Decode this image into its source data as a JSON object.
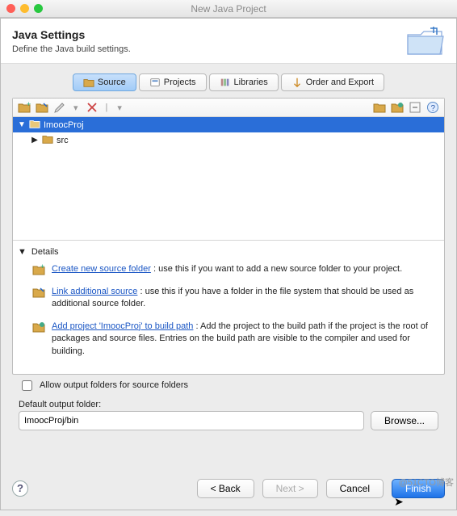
{
  "window": {
    "title": "New Java Project"
  },
  "header": {
    "title": "Java Settings",
    "subtitle": "Define the Java build settings."
  },
  "tabs": {
    "source": "Source",
    "projects": "Projects",
    "libraries": "Libraries",
    "order": "Order and Export"
  },
  "tree": {
    "project": "ImoocProj",
    "src": "src"
  },
  "details": {
    "heading": "Details",
    "item1": {
      "link": "Create new source folder",
      "text": " : use this if you want to add a new source folder to your project."
    },
    "item2": {
      "link": "Link additional source",
      "text": " : use this if you have a folder in the file system that should be used as additional source folder."
    },
    "item3": {
      "link": "Add project 'ImoocProj' to build path",
      "text": " : Add the project to the build path if the project is the root of packages and source files. Entries on the build path are visible to the compiler and used for building."
    }
  },
  "options": {
    "allow_label": "Allow output folders for source folders",
    "default_output_label": "Default output folder:",
    "default_output_value": "ImoocProj/bin",
    "browse": "Browse..."
  },
  "footer": {
    "back": "< Back",
    "next": "Next >",
    "cancel": "Cancel",
    "finish": "Finish"
  },
  "watermark": "@51CTO博客"
}
